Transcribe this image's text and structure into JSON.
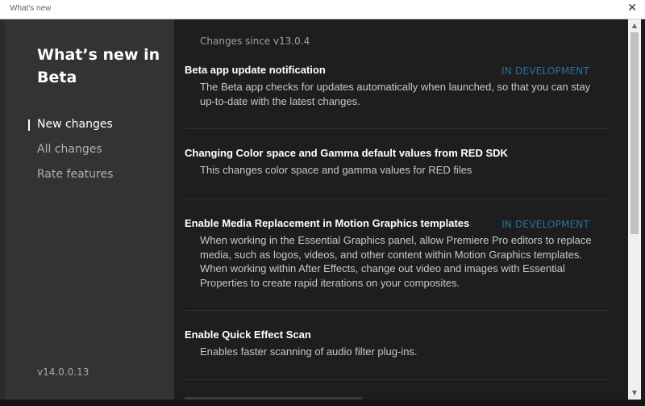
{
  "window": {
    "title": "What's new",
    "close_glyph": "✕"
  },
  "sidebar": {
    "heading": "What’s new in Beta",
    "nav": [
      {
        "label": "New changes",
        "active": true
      },
      {
        "label": "All changes",
        "active": false
      },
      {
        "label": "Rate features",
        "active": false
      }
    ],
    "version": "v14.0.0.13"
  },
  "content": {
    "since": "Changes since v13.0.4",
    "items": [
      {
        "title": "Beta app update notification",
        "badge": "IN DEVELOPMENT",
        "description": "The Beta app checks for updates automatically when launched, so that you can stay up-to-date with the latest changes."
      },
      {
        "title": "Changing Color space and Gamma default values from RED SDK",
        "badge": "",
        "description": "This changes color space and gamma values for RED files"
      },
      {
        "title": "Enable Media Replacement in Motion Graphics templates",
        "badge": "IN DEVELOPMENT",
        "description": "When working in the Essential Graphics panel, allow Premiere Pro editors to replace media, such as logos, videos, and other content within Motion Graphics templates. When working within After Effects, change out video and images with Essential Properties to create rapid iterations on your composites."
      },
      {
        "title": "Enable Quick Effect Scan",
        "badge": "",
        "description": "Enables faster scanning of audio filter plug-ins."
      }
    ]
  },
  "colors": {
    "badge": "#2d6f9a",
    "sidebar_bg": "#333333",
    "content_bg": "#1e1e1e"
  }
}
